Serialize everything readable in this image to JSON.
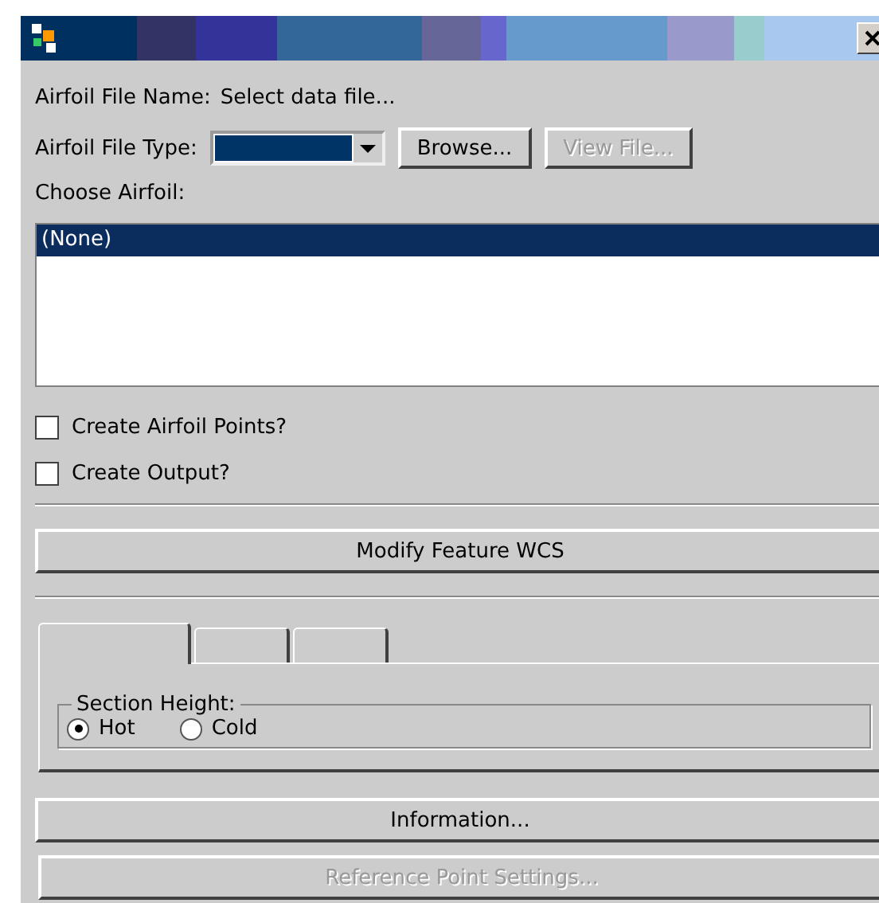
{
  "file_name": {
    "label": "Airfoil File Name:",
    "value": "Select data file..."
  },
  "file_type": {
    "label": "Airfoil File Type:"
  },
  "buttons_top": [
    {
      "label": "Browse...",
      "disabled": false
    },
    {
      "label": "View File...",
      "disabled": true
    }
  ],
  "choose_label": "Choose Airfoil:",
  "airfoils": [
    {
      "label": "(None)",
      "selected": true
    }
  ],
  "checkboxes": [
    {
      "label": "Create Airfoil Points?",
      "checked": false
    },
    {
      "label": "Create Output?",
      "checked": false
    }
  ],
  "modify_button": {
    "label": "Modify Feature WCS",
    "disabled": false
  },
  "tabs": [
    {
      "selected": true
    },
    {
      "selected": false
    },
    {
      "selected": false
    }
  ],
  "section_height": {
    "label": "Section Height:",
    "options": [
      {
        "label": "Hot",
        "selected": true
      },
      {
        "label": "Cold",
        "selected": false
      }
    ]
  },
  "bottom_buttons": [
    {
      "label": "Information...",
      "disabled": false
    },
    {
      "label": "Reference Point Settings...",
      "disabled": true
    }
  ]
}
